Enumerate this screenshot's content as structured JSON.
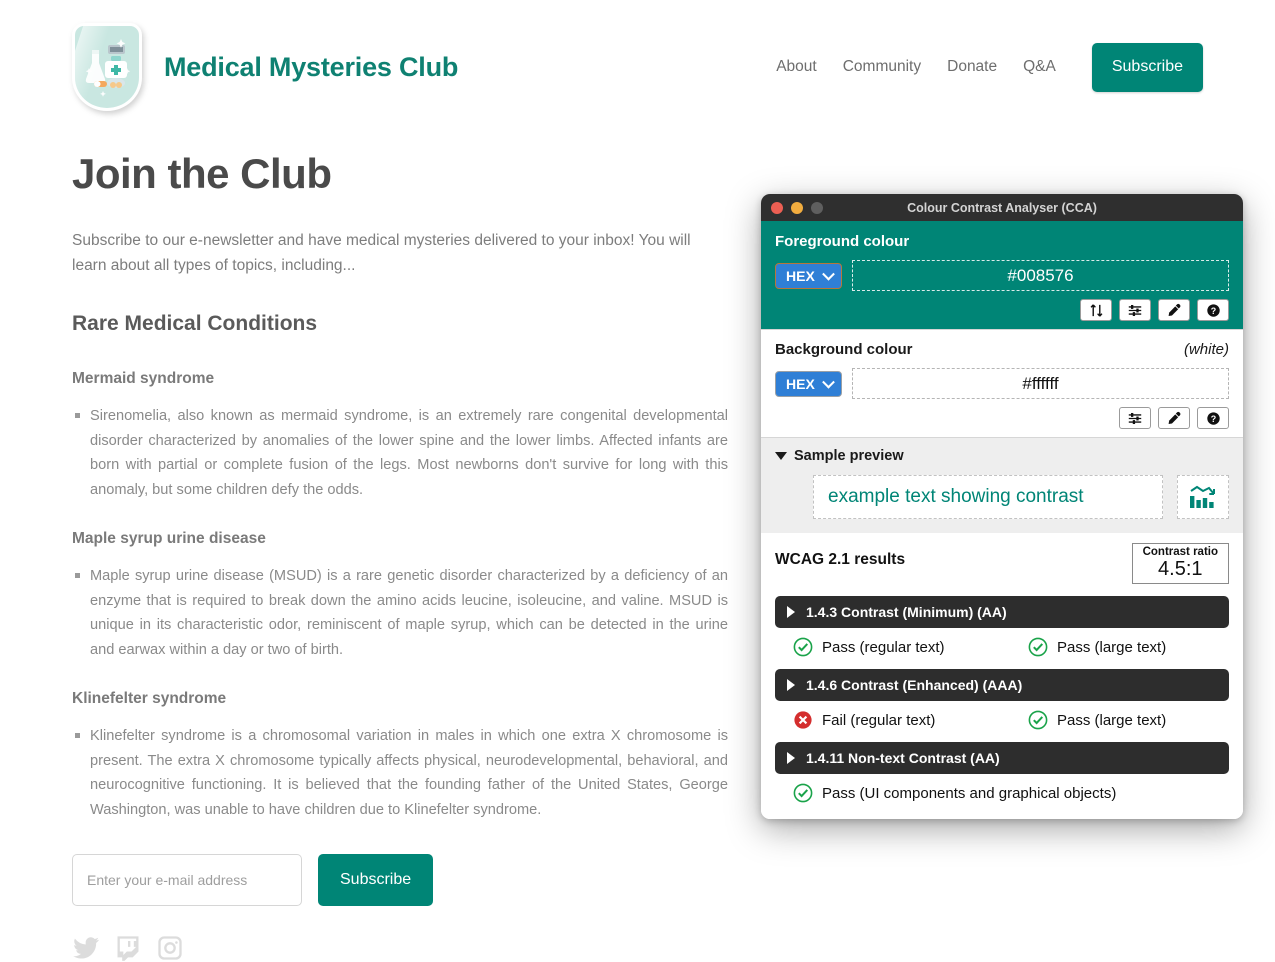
{
  "site": {
    "brand_title": "Medical Mysteries Club",
    "logo_icon": "medical-shield-badge-icon",
    "nav": [
      {
        "label": "About"
      },
      {
        "label": "Community"
      },
      {
        "label": "Donate"
      },
      {
        "label": "Q&A"
      }
    ],
    "nav_cta": "Subscribe",
    "page_title": "Join the Club",
    "lede": "Subscribe to our e-newsletter and have medical mysteries delivered to your inbox! You will learn about all types of topics, including...",
    "section_heading": "Rare Medical Conditions",
    "conditions": [
      {
        "heading": "Mermaid syndrome",
        "body": "Sirenomelia, also known as mermaid syndrome, is an extremely rare congenital developmental disorder characterized by anomalies of the lower spine and the lower limbs. Affected infants are born with partial or complete fusion of the legs. Most newborns don't survive for long with this anomaly, but some children defy the odds."
      },
      {
        "heading": "Maple syrup urine disease",
        "body": "Maple syrup urine disease (MSUD) is a rare genetic disorder characterized by a deficiency of an enzyme that is required to break down the amino acids leucine, isoleucine, and valine. MSUD is unique in its characteristic odor, reminiscent of maple syrup, which can be detected in the urine and earwax within a day or two of birth."
      },
      {
        "heading": "Klinefelter syndrome",
        "body": "Klinefelter syndrome is a chromosomal variation in males in which one extra X chromosome is present. The extra X chromosome typically affects physical, neurodevelopmental, behavioral, and neurocognitive functioning. It is believed that the founding father of the United States, George Washington, was unable to have children due to Klinefelter syndrome."
      }
    ],
    "signup": {
      "email_placeholder": "Enter your e-mail address",
      "email_value": "",
      "submit_label": "Subscribe"
    },
    "socials": [
      {
        "name": "twitter-icon"
      },
      {
        "name": "twitch-icon"
      },
      {
        "name": "instagram-icon"
      }
    ],
    "accent_color": "#008576",
    "brand_color": "#0f8172"
  },
  "cca": {
    "window_title": "Colour Contrast Analyser (CCA)",
    "traffic_lights": [
      "close",
      "minimise",
      "zoom"
    ],
    "foreground": {
      "title": "Foreground colour",
      "format": "HEX",
      "value": "#008576",
      "buttons": [
        {
          "name": "swap-colours-button",
          "icon": "swap-vertical-icon"
        },
        {
          "name": "adjust-sliders-button",
          "icon": "sliders-icon"
        },
        {
          "name": "eyedropper-button",
          "icon": "eyedropper-icon"
        },
        {
          "name": "help-button",
          "icon": "question-circle-icon"
        }
      ]
    },
    "background": {
      "title": "Background colour",
      "note": "(white)",
      "format": "HEX",
      "value": "#ffffff",
      "buttons": [
        {
          "name": "adjust-sliders-button",
          "icon": "sliders-icon"
        },
        {
          "name": "eyedropper-button",
          "icon": "eyedropper-icon"
        },
        {
          "name": "help-button",
          "icon": "question-circle-icon"
        }
      ]
    },
    "preview": {
      "title": "Sample preview",
      "sample_text": "example text showing contrast",
      "sample_icon": "bar-chart-declining-icon"
    },
    "results": {
      "title": "WCAG 2.1 results",
      "ratio_label": "Contrast ratio",
      "ratio_value": "4.5:1",
      "criteria": [
        {
          "label": "1.4.3 Contrast (Minimum) (AA)",
          "verdicts": [
            {
              "status": "pass",
              "text": "Pass (regular text)"
            },
            {
              "status": "pass",
              "text": "Pass (large text)"
            }
          ]
        },
        {
          "label": "1.4.6 Contrast (Enhanced) (AAA)",
          "verdicts": [
            {
              "status": "fail",
              "text": "Fail (regular text)"
            },
            {
              "status": "pass",
              "text": "Pass (large text)"
            }
          ]
        },
        {
          "label": "1.4.11 Non-text Contrast (AA)",
          "verdicts": [
            {
              "status": "pass",
              "text": "Pass (UI components and graphical objects)"
            }
          ]
        }
      ],
      "pass_color": "#1aa34a",
      "fail_color": "#d42e2e"
    }
  }
}
